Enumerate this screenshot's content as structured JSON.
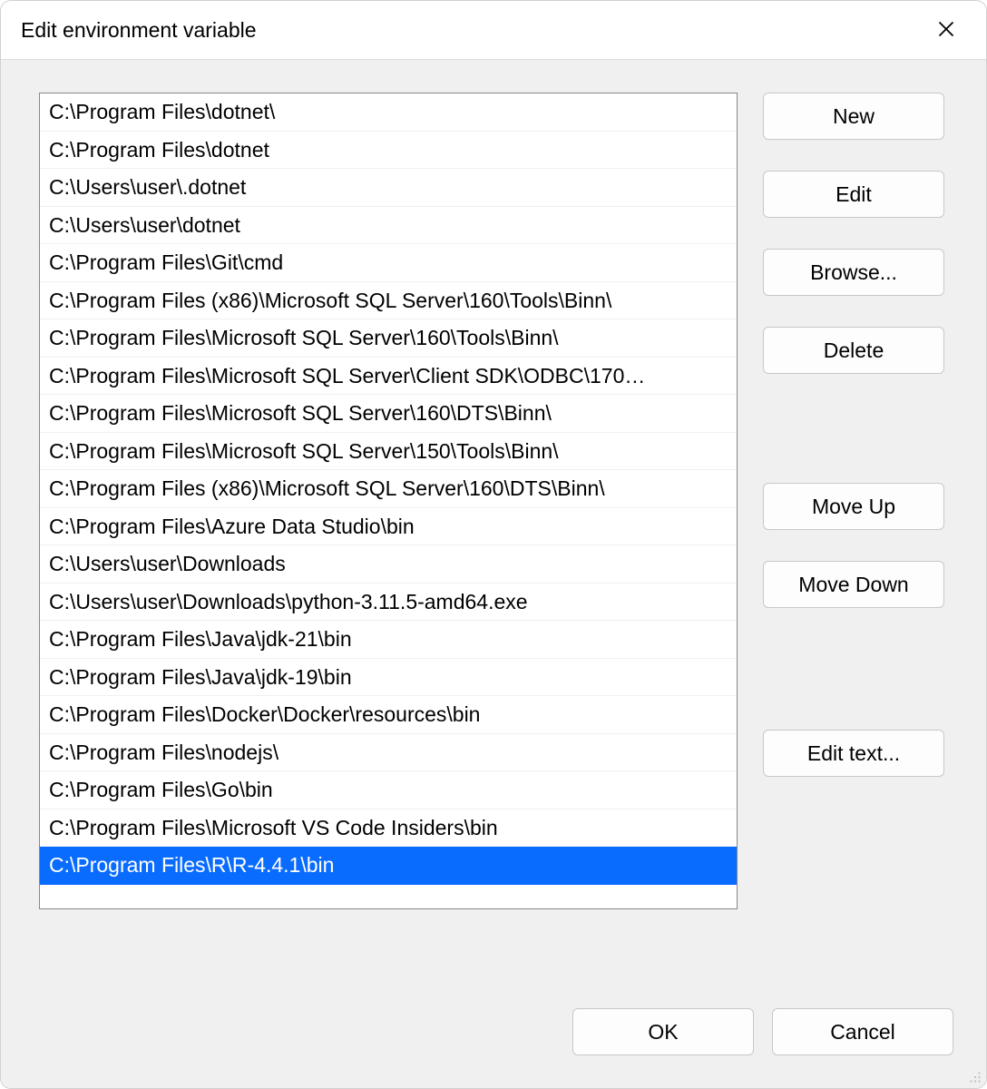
{
  "dialog": {
    "title": "Edit environment variable"
  },
  "list": {
    "items": [
      {
        "path": "C:\\Program Files\\dotnet\\",
        "selected": false
      },
      {
        "path": "C:\\Program Files\\dotnet",
        "selected": false
      },
      {
        "path": "C:\\Users\\user\\.dotnet",
        "selected": false
      },
      {
        "path": "C:\\Users\\user\\dotnet",
        "selected": false
      },
      {
        "path": "C:\\Program Files\\Git\\cmd",
        "selected": false
      },
      {
        "path": "C:\\Program Files (x86)\\Microsoft SQL Server\\160\\Tools\\Binn\\",
        "selected": false
      },
      {
        "path": "C:\\Program Files\\Microsoft SQL Server\\160\\Tools\\Binn\\",
        "selected": false
      },
      {
        "path": "C:\\Program Files\\Microsoft SQL Server\\Client SDK\\ODBC\\170…",
        "selected": false
      },
      {
        "path": "C:\\Program Files\\Microsoft SQL Server\\160\\DTS\\Binn\\",
        "selected": false
      },
      {
        "path": "C:\\Program Files\\Microsoft SQL Server\\150\\Tools\\Binn\\",
        "selected": false
      },
      {
        "path": "C:\\Program Files (x86)\\Microsoft SQL Server\\160\\DTS\\Binn\\",
        "selected": false
      },
      {
        "path": "C:\\Program Files\\Azure Data Studio\\bin",
        "selected": false
      },
      {
        "path": "C:\\Users\\user\\Downloads",
        "selected": false
      },
      {
        "path": "C:\\Users\\user\\Downloads\\python-3.11.5-amd64.exe",
        "selected": false
      },
      {
        "path": "C:\\Program Files\\Java\\jdk-21\\bin",
        "selected": false
      },
      {
        "path": "C:\\Program Files\\Java\\jdk-19\\bin",
        "selected": false
      },
      {
        "path": "C:\\Program Files\\Docker\\Docker\\resources\\bin",
        "selected": false
      },
      {
        "path": "C:\\Program Files\\nodejs\\",
        "selected": false
      },
      {
        "path": "C:\\Program Files\\Go\\bin",
        "selected": false
      },
      {
        "path": "C:\\Program Files\\Microsoft VS Code Insiders\\bin",
        "selected": false
      },
      {
        "path": "C:\\Program Files\\R\\R-4.4.1\\bin",
        "selected": true
      }
    ]
  },
  "buttons": {
    "new": "New",
    "edit": "Edit",
    "browse": "Browse...",
    "delete": "Delete",
    "moveUp": "Move Up",
    "moveDown": "Move Down",
    "editText": "Edit text...",
    "ok": "OK",
    "cancel": "Cancel"
  }
}
